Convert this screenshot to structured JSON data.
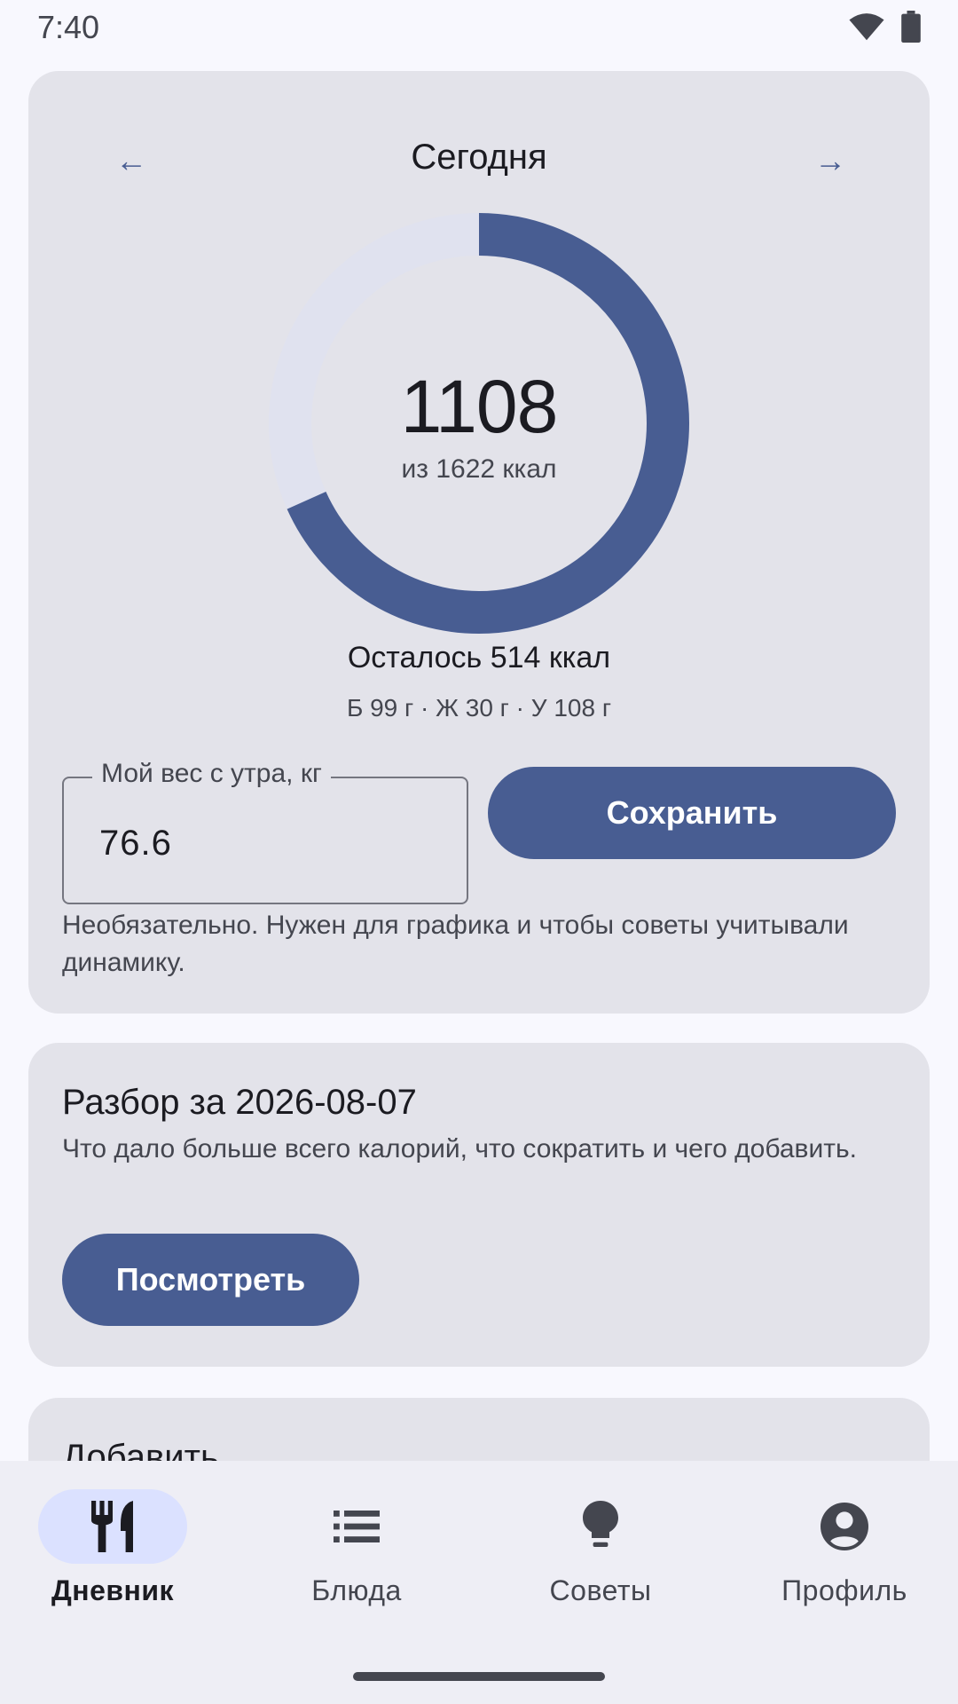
{
  "status": {
    "time": "7:40"
  },
  "today": {
    "title": "Сегодня",
    "prev_arrow": "←",
    "next_arrow": "→",
    "consumed": "1108",
    "of_goal": "из 1622 ккал",
    "consumed_fraction": 0.683,
    "remaining": "Осталось 514 ккал",
    "macros": "Б 99 г · Ж 30 г · У 108 г"
  },
  "weight": {
    "label": "Мой вес с утра, кг",
    "value": "76.6",
    "save_label": "Сохранить",
    "hint": "Необязательно. Нужен для графика и чтобы советы учитывали динамику."
  },
  "review": {
    "title": "Разбор за 2026-08-07",
    "description": "Что дало больше всего калорий, что сократить и чего добавить.",
    "button_label": "Посмотреть"
  },
  "add": {
    "title": "Добавить"
  },
  "nav": {
    "items": [
      {
        "label": "Дневник",
        "icon": "restaurant-icon",
        "active": true
      },
      {
        "label": "Блюда",
        "icon": "list-icon",
        "active": false
      },
      {
        "label": "Советы",
        "icon": "lightbulb-icon",
        "active": false
      },
      {
        "label": "Профиль",
        "icon": "account-circle-icon",
        "active": false
      }
    ]
  },
  "colors": {
    "accent": "#485d92",
    "card": "#e3e3ea",
    "ring_track": "#e0e2ef",
    "nav_active_pill": "#dbe1ff"
  }
}
